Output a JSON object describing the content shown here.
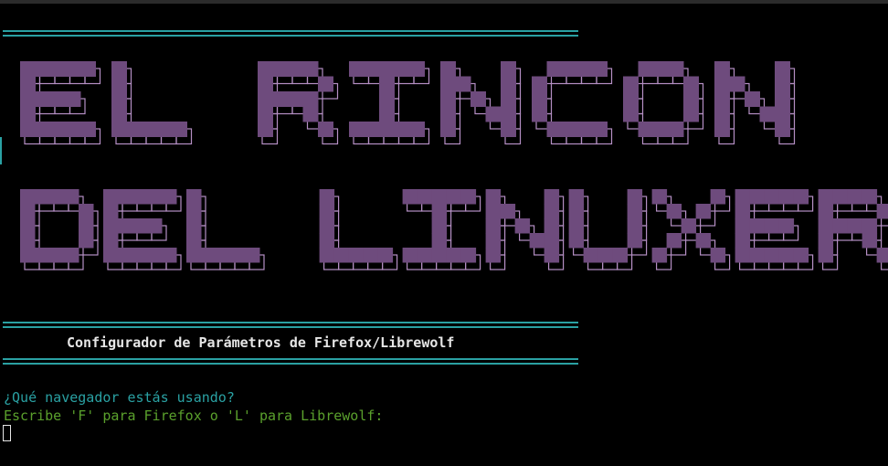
{
  "banner": {
    "line1": "EL RINCON",
    "line2": "DEL LINUXERO"
  },
  "subtitle": "Configurador de Parámetros de Firefox/Librewolf",
  "prompt": {
    "question": "¿Qué navegador estás usando?",
    "instruction": "Escribe 'F' para Firefox o 'L' para Librewolf:"
  },
  "colors": {
    "background": "#000000",
    "rule": "#2aa1a3",
    "banner_fill": "#6e4b7d",
    "banner_outline": "#b58fc4",
    "subtitle": "#e6e6e6",
    "question": "#2aa1a3",
    "instruction": "#5aa02c"
  }
}
